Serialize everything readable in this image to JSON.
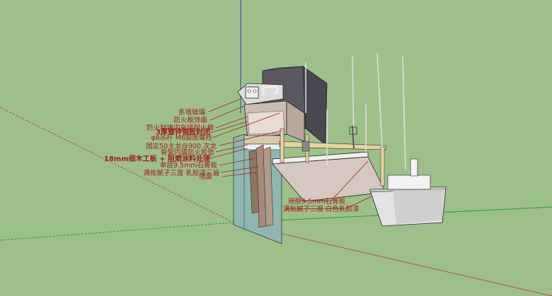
{
  "labels": {
    "l1": "系墙玻璃",
    "l2": "防火板饰面",
    "l3": "防火封堵内充填耐火棉",
    "l4": "3厚镀锌钢板封闭",
    "l5": "φ8吊杆 M8膨胀螺栓",
    "l6": "固定50主龙@900 次龙",
    "l7": "骨架内填防火胶垫",
    "l8": "18mm细木工板 + 阻燃涂料处理",
    "l9": "单层9.5mm石膏板",
    "l10": "满批腻子三度 乳胶漆三遍",
    "l11": "墙面",
    "r1": "双层9.5mm石膏板",
    "r2": "满批腻子三度 白色乳胶漆"
  },
  "colors": {
    "background": "#9dc08b",
    "label": "#a01c1c",
    "axis_red": "#b84a4a",
    "axis_green": "#2e9a2e",
    "axis_blue": "#2244cc"
  }
}
